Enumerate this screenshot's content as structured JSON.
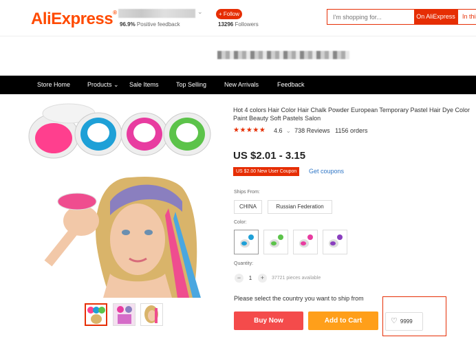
{
  "header": {
    "logo_text": "AliExpress",
    "logo_reg": "®",
    "positive_percent": "96.9%",
    "positive_label": "Positive feedback",
    "follow_label": "+ Follow",
    "followers_count": "13296",
    "followers_label": "Followers",
    "search_placeholder": "I'm shopping for...",
    "search_button": "On AliExpress",
    "search_button2": "In this store",
    "store_caret": "⌄"
  },
  "nav": {
    "items": [
      "Store Home",
      "Products",
      "Sale Items",
      "Top Selling",
      "New Arrivals",
      "Feedback"
    ],
    "products_caret": "⌄"
  },
  "product": {
    "title": "Hot 4 colors Hair Color Hair Chalk Powder European Temporary Pastel Hair Dye Color Paint Beauty Soft Pastels Salon",
    "stars": "★★★★★",
    "rating": "4.6",
    "reviews": "738 Reviews",
    "orders": "1156 orders",
    "price": "US $2.01 - 3.15",
    "coupon_badge": "US $2.00 New User Coupon",
    "get_coupons": "Get coupons",
    "ships_from_label": "Ships From:",
    "ships_from_options": [
      "CHINA",
      "Russian Federation"
    ],
    "color_label": "Color:",
    "color_options": [
      "blue",
      "green",
      "pink",
      "purple"
    ],
    "quantity_label": "Quantity:",
    "qty_minus": "−",
    "qty_plus": "+",
    "quantity_value": "1",
    "pieces_available": "37721 pieces available",
    "ship_note": "Please select the country you want to ship from",
    "buy_now": "Buy Now",
    "add_to_cart": "Add to Cart",
    "wishlist_count": "9999",
    "heart": "♡"
  },
  "colors": {
    "accent": "#e62e04",
    "buy": "#f44b4b",
    "cart": "#ff9f1a",
    "link": "#2f76c6",
    "nav_bg": "#000000"
  }
}
